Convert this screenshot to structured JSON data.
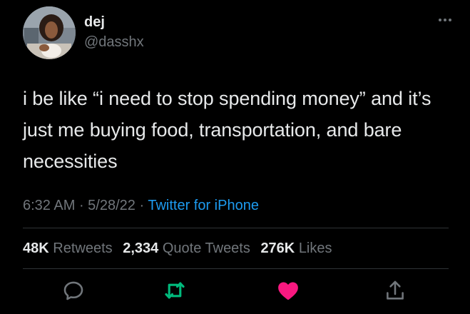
{
  "user": {
    "display_name": "dej",
    "handle": "@dasshx"
  },
  "tweet": {
    "text": "i be like “i need to stop spending money” and it’s just me buying food, transportation, and bare necessities",
    "time": "6:32 AM",
    "separator": " · ",
    "date": "5/28/22",
    "source": "Twitter for iPhone"
  },
  "stats": {
    "retweets_count": "48K",
    "retweets_label": "Retweets",
    "quotes_count": "2,334",
    "quotes_label": "Quote Tweets",
    "likes_count": "276K",
    "likes_label": "Likes"
  },
  "icons": {
    "more": "more-horizontal-icon",
    "reply": "reply-icon",
    "retweet": "retweet-icon",
    "like": "heart-icon",
    "share": "share-icon"
  },
  "colors": {
    "background": "#000000",
    "text": "#e7e9ea",
    "muted": "#71767b",
    "link": "#1d9bf0",
    "retweet": "#00ba7c",
    "like": "#f91880"
  }
}
